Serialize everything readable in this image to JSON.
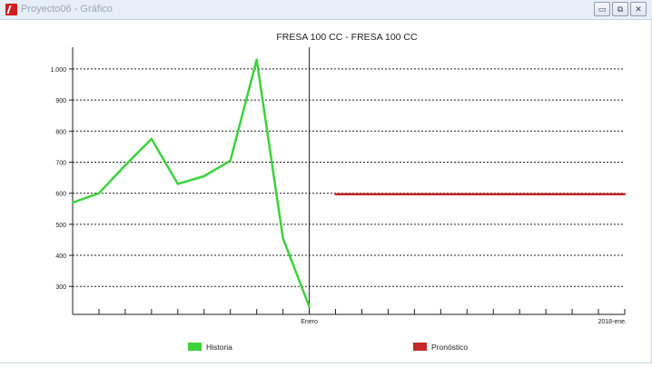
{
  "window": {
    "title": "Proyecto06 - Gráfico",
    "buttons": {
      "minimize": "▭",
      "restore": "⧉",
      "close": "✕"
    }
  },
  "chart_data": {
    "type": "line",
    "title": "FRESA 100 CC - FRESA 100 CC",
    "xlabel": "",
    "ylabel": "",
    "y_ticks": [
      "1.000",
      "900",
      "800",
      "700",
      "600",
      "500",
      "400",
      "300"
    ],
    "y_tick_values": [
      1000,
      900,
      800,
      700,
      600,
      500,
      400,
      300
    ],
    "ylim": [
      210,
      1070
    ],
    "x_period_count": 21,
    "x_tick_labels": [
      {
        "index": 9,
        "label": "Enero"
      },
      {
        "index": 21,
        "label": "2018-ene."
      }
    ],
    "divider_index": 9,
    "grid": true,
    "legend_position": "bottom",
    "series": [
      {
        "name": "Historia",
        "color": "#3cd23c",
        "points": [
          [
            0,
            570
          ],
          [
            1,
            600
          ],
          [
            2,
            690
          ],
          [
            3,
            775
          ],
          [
            4,
            630
          ],
          [
            5,
            655
          ],
          [
            6,
            705
          ],
          [
            7,
            1030
          ],
          [
            8,
            455
          ],
          [
            9,
            235
          ]
        ]
      },
      {
        "name": "Pronóstico",
        "color": "#c42a2a",
        "points": [
          [
            10,
            597
          ],
          [
            21,
            597
          ]
        ]
      }
    ]
  }
}
